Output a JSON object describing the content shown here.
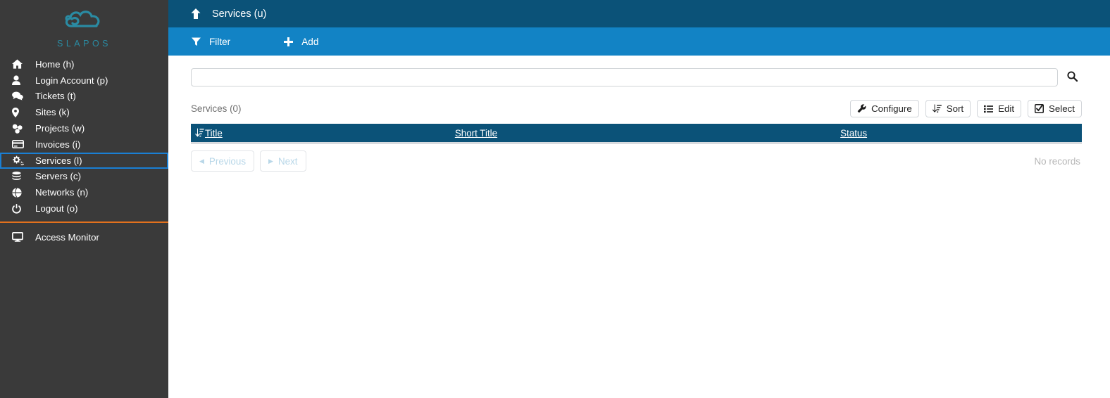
{
  "sidebar": {
    "logo": {
      "text": "SLAPOS",
      "icon": "cloud-logo-icon",
      "color": "#2a8ba3"
    },
    "items": [
      {
        "label": "Home (h)",
        "icon": "home-icon",
        "active": false
      },
      {
        "label": "Login Account (p)",
        "icon": "user-icon",
        "active": false
      },
      {
        "label": "Tickets (t)",
        "icon": "comments-icon",
        "active": false
      },
      {
        "label": "Sites (k)",
        "icon": "map-marker-icon",
        "active": false
      },
      {
        "label": "Projects (w)",
        "icon": "cubes-icon",
        "active": false
      },
      {
        "label": "Invoices (i)",
        "icon": "credit-card-icon",
        "active": false
      },
      {
        "label": "Services (l)",
        "icon": "cogs-icon",
        "active": true
      },
      {
        "label": "Servers (c)",
        "icon": "database-icon",
        "active": false
      },
      {
        "label": "Networks (n)",
        "icon": "globe-icon",
        "active": false
      },
      {
        "label": "Logout (o)",
        "icon": "power-off-icon",
        "active": false
      }
    ],
    "bottom_items": [
      {
        "label": "Access Monitor",
        "icon": "desktop-icon"
      }
    ],
    "divider_color": "#e2711d",
    "background": "#3a3a3a",
    "active_border_color": "#1a7fd4"
  },
  "header": {
    "title": "Services (u)",
    "up_icon": "arrow-up-icon",
    "background": "#0b5278"
  },
  "toolbar": {
    "background": "#1283c5",
    "buttons": [
      {
        "label": "Filter",
        "icon": "filter-icon"
      },
      {
        "label": "Add",
        "icon": "plus-icon"
      }
    ]
  },
  "search": {
    "value": "",
    "placeholder": "",
    "icon": "search-icon"
  },
  "listing": {
    "count_label": "Services (0)",
    "actions": [
      {
        "label": "Configure",
        "icon": "wrench-icon"
      },
      {
        "label": "Sort",
        "icon": "sort-amount-icon"
      },
      {
        "label": "Edit",
        "icon": "list-icon"
      },
      {
        "label": "Select",
        "icon": "check-square-icon"
      }
    ],
    "columns": [
      {
        "label": "Title",
        "sort_icon": "sort-amount-asc-icon"
      },
      {
        "label": "Short Title",
        "sort_icon": ""
      },
      {
        "label": "Status",
        "sort_icon": ""
      }
    ],
    "rows": [],
    "empty_text": "No records",
    "header_background": "#0b5278"
  },
  "pagination": {
    "previous_label": "Previous",
    "previous_icon": "caret-left-icon",
    "previous_disabled": true,
    "next_label": "Next",
    "next_icon": "caret-right-icon",
    "next_disabled": true
  }
}
